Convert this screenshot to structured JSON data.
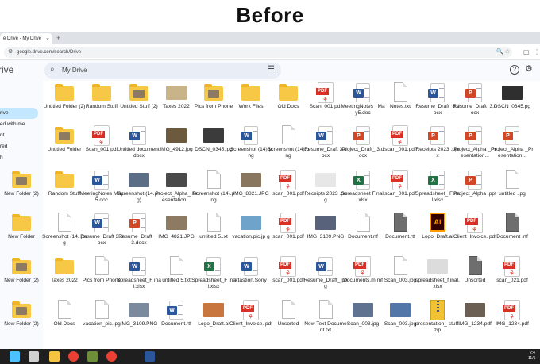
{
  "banner": {
    "title": "Before"
  },
  "browser": {
    "tab_title": "e Drive - My Drive",
    "tab_close": "×",
    "new_tab": "+",
    "url": "google.drive.com/search/Drive",
    "url_icon": "⚙",
    "url_right_icons": [
      "🔍",
      "☆"
    ],
    "ext_icons": [
      "▢",
      "⋮"
    ]
  },
  "drive": {
    "brand": "rive",
    "search_placeholder": "My Drive",
    "search_icon": "⌕",
    "tune_icon": "☰",
    "help_icon": "?",
    "gear_icon": "⚙"
  },
  "sidebar": {
    "items": [
      {
        "label": "rive",
        "active": true
      },
      {
        "label": "ed with me",
        "active": false
      },
      {
        "label": "nt",
        "active": false
      },
      {
        "label": "red",
        "active": false
      },
      {
        "label": "h",
        "active": false
      }
    ]
  },
  "files": [
    {
      "t": "folder",
      "l": "Untitled Folder (2)"
    },
    {
      "t": "folder",
      "l": "Random Stuff"
    },
    {
      "t": "folder",
      "l": "Untitled Stuff (2)",
      "thumb": true
    },
    {
      "t": "img",
      "l": "Taxes 2022",
      "c": "#c9b48a"
    },
    {
      "t": "folder",
      "l": "Pics from Phone",
      "thumb": true
    },
    {
      "t": "folder",
      "l": "Work Files"
    },
    {
      "t": "folder",
      "l": "Old Docs"
    },
    {
      "t": "pdf",
      "l": "Scan_001.pdf"
    },
    {
      "t": "word",
      "l": "MeetingNotes _May5.doc"
    },
    {
      "t": "blank",
      "l": "Notes.txt"
    },
    {
      "t": "word",
      "l": "Resume_Draft_3.docx"
    },
    {
      "t": "ppt",
      "l": "Resume_Draft_3.docx"
    },
    {
      "t": "img",
      "l": "DSCN_0345.pg",
      "c": "#2f2f2f"
    },
    {
      "t": "ppt",
      "l": ""
    },
    {
      "t": "folder",
      "l": "Untitled Folder",
      "thumb": true
    },
    {
      "t": "pdf",
      "l": "Scan_001.pdf"
    },
    {
      "t": "word",
      "l": "Untitled document.docx"
    },
    {
      "t": "img",
      "l": "IMG_4912.jpg",
      "c": "#6b5a3e"
    },
    {
      "t": "img",
      "l": "DSCN_0345.jpg",
      "c": "#3b3b3b"
    },
    {
      "t": "word",
      "l": "Screenshot (14).png"
    },
    {
      "t": "blank",
      "l": "Screenshot (14).png"
    },
    {
      "t": "word",
      "l": "Resume_Draft 3.docx"
    },
    {
      "t": "ppt",
      "l": "Project_Draft_ 3.docx"
    },
    {
      "t": "pdf",
      "l": "scan_001.pdf"
    },
    {
      "t": "ppt",
      "l": "Receipts 2023 .pptx"
    },
    {
      "t": "ppt",
      "l": "Project_Alpha _Presentation..."
    },
    {
      "t": "ppt",
      "l": "Project_Alpha _Presentation..."
    },
    {
      "t": "blank",
      "l": ""
    },
    {
      "t": "folder",
      "l": "New Folder (2)",
      "thumb": true
    },
    {
      "t": "folder",
      "l": "Random Stuff"
    },
    {
      "t": "word",
      "l": "MeetingNotes May5.doc"
    },
    {
      "t": "img",
      "l": "Screenshot (14.png)",
      "c": "#5b6e86"
    },
    {
      "t": "img",
      "l": "Project_Alpha_ Presentation...",
      "c": "#4a4a4a"
    },
    {
      "t": "blank",
      "l": "Screenshot (14).png"
    },
    {
      "t": "img",
      "l": "IMG_8821.JPG",
      "c": "#8a7760"
    },
    {
      "t": "pdf",
      "l": "scan_001.pdf"
    },
    {
      "t": "img",
      "l": "Receipts 2023 .png",
      "c": "#e7e7e7"
    },
    {
      "t": "excel",
      "l": "Spreadsheet Final.xlsx"
    },
    {
      "t": "pdf",
      "l": "scan_001.pdf"
    },
    {
      "t": "excel",
      "l": "Spreadsheet_ Final.xlsx"
    },
    {
      "t": "ppt",
      "l": "Project_Alpha .ppt"
    },
    {
      "t": "blank",
      "l": "untitled .jpg"
    },
    {
      "t": "blank",
      "l": "IMG"
    },
    {
      "t": "blank",
      "l": ""
    },
    {
      "t": "folder",
      "l": "New Folder"
    },
    {
      "t": "blank",
      "l": "Screenshot (14. png"
    },
    {
      "t": "word",
      "l": "Resume_Draft 3.docx"
    },
    {
      "t": "ppt",
      "l": "Resume_Draft_ _3.docx"
    },
    {
      "t": "img",
      "l": "IMG_4821.JPG",
      "c": "#8d7a62"
    },
    {
      "t": "blank",
      "l": "untitled 5..xt"
    },
    {
      "t": "img",
      "l": "vacation.pic.jp g",
      "c": "#6fa3c9"
    },
    {
      "t": "pdf",
      "l": "scan_001.pdf"
    },
    {
      "t": "img",
      "l": "IMG_3109.PNG",
      "c": "#58627a"
    },
    {
      "t": "blank",
      "l": "Document.rtf"
    },
    {
      "t": "darkblank",
      "l": "Document.rtf"
    },
    {
      "t": "ai",
      "l": "Logo_Draft.ai"
    },
    {
      "t": "pdf",
      "l": "Client_Invoice. pdf"
    },
    {
      "t": "darkblank",
      "l": "Document .rtf"
    },
    {
      "t": "folder",
      "l": "New Folder (2)",
      "thumb": true
    },
    {
      "t": "folder",
      "l": "Taxes 2022"
    },
    {
      "t": "blank",
      "l": "Pics from Phone"
    },
    {
      "t": "word",
      "l": "Spreadsheet_F inal.xlsx"
    },
    {
      "t": "blank",
      "l": "untitled 5.txt"
    },
    {
      "t": "excel",
      "l": "Spreadsheet_F inal.xlsx"
    },
    {
      "t": "word",
      "l": "ktastion,Sony"
    },
    {
      "t": "pdf",
      "l": "scan_001.pdf"
    },
    {
      "t": "word",
      "l": "Resume_Draft_ png"
    },
    {
      "t": "pdf",
      "l": "Documents.m mf"
    },
    {
      "t": "blank",
      "l": "Scan_003.jpg"
    },
    {
      "t": "img",
      "l": "spreadsheet_f inal.xlsx",
      "c": "#dcdcdc"
    },
    {
      "t": "darkblank",
      "l": "Unsorted"
    },
    {
      "t": "pdf",
      "l": "scan_021.pdf"
    },
    {
      "t": "folder",
      "l": "New Folder (2)",
      "thumb": true
    },
    {
      "t": "blank",
      "l": "Old Docs"
    },
    {
      "t": "blank",
      "l": "vacation_pic. pg"
    },
    {
      "t": "img",
      "l": "IMG_3109.PNG",
      "c": "#7c8a9e"
    },
    {
      "t": "word",
      "l": "Document.rtf"
    },
    {
      "t": "img",
      "l": "Logo_Draft.ai",
      "c": "#c8763d"
    },
    {
      "t": "pdf",
      "l": "Client_Invoice. pdf"
    },
    {
      "t": "blank",
      "l": "Unsorted"
    },
    {
      "t": "blank",
      "l": "New Text Document.txt"
    },
    {
      "t": "img",
      "l": "Scan_003.jpg",
      "c": "#5f7391"
    },
    {
      "t": "img",
      "l": "Scan_003.jpg",
      "c": "#5276a8"
    },
    {
      "t": "zip",
      "l": "presentation_ stuff.zip"
    },
    {
      "t": "img",
      "l": "IMG_1234.pdf",
      "c": "#6b5e52"
    },
    {
      "t": "pdf",
      "l": "IMG_1234.pdf"
    }
  ],
  "labels": {
    "pdf": "PDF",
    "word": "W",
    "excel": "X",
    "ppt": "P",
    "ai": "Ai",
    "acrobat": "⚘"
  },
  "taskbar": {
    "time": "2:4",
    "date": "11/1",
    "icons": [
      "windows-icon",
      "search-icon",
      "file-explorer-icon",
      "chrome-icon",
      "app-icon",
      "chrome-icon",
      "word-icon"
    ]
  }
}
